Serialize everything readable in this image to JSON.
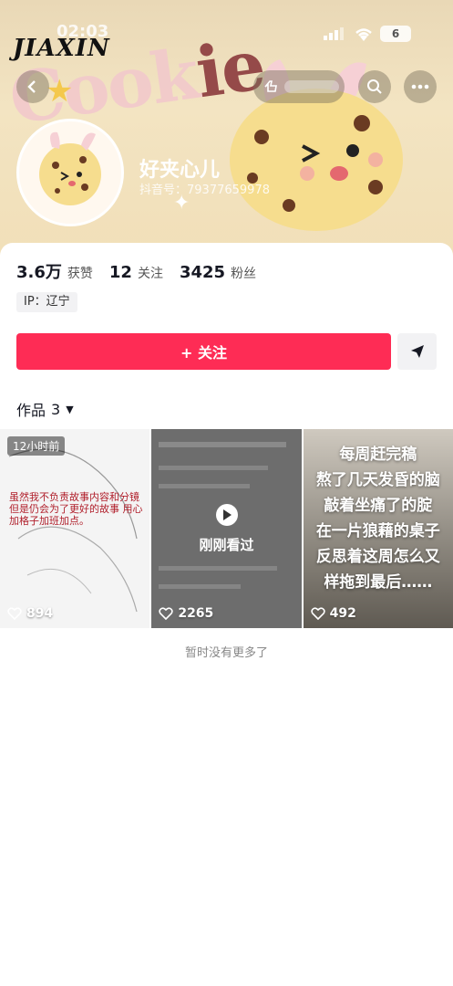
{
  "status_bar": {
    "time": "02:03",
    "battery": "6"
  },
  "watermark": "JIAXIN",
  "banner": {
    "word_main": "Cook",
    "word_accent": "ie"
  },
  "profile": {
    "nickname": "好夹心儿",
    "douyin_id": "抖音号：79377659978"
  },
  "stats": [
    {
      "value": "3.6万",
      "label": "获赞"
    },
    {
      "value": "12",
      "label": "关注"
    },
    {
      "value": "3425",
      "label": "粉丝"
    }
  ],
  "ip": "IP：辽宁",
  "follow_button": "+ 关注",
  "works_tab": {
    "label": "作品",
    "count": "3"
  },
  "videos": [
    {
      "badge": "12小时前",
      "caption": "虽然我不负责故事内容和分镜 但是仍会为了更好的故事 用心加格子加班加点。",
      "likes": "894"
    },
    {
      "overlay": "刚刚看过",
      "likes": "2265"
    },
    {
      "overlay_lines": [
        "每周赶完稿",
        "熬了几天发昏的脑",
        "敲着坐痛了的腚",
        "在一片狼藉的桌子",
        "反思着这周怎么又",
        "样拖到最后……"
      ],
      "likes": "492"
    }
  ],
  "footer_text": "暂时没有更多了",
  "colors": {
    "accent": "#fe2c55",
    "text": "#161823",
    "muted": "#888888"
  }
}
